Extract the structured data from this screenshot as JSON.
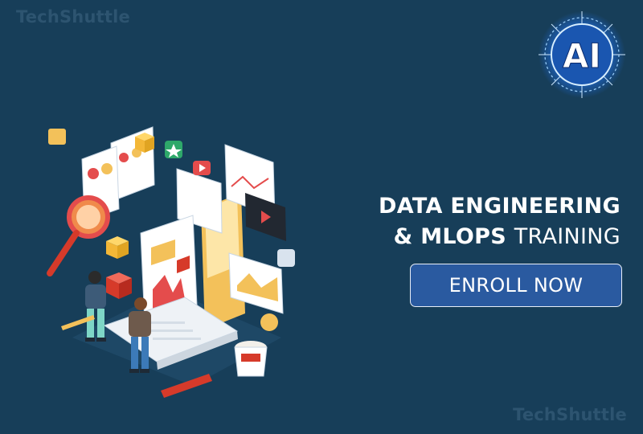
{
  "brand": {
    "name": "TechShuttle"
  },
  "badge": {
    "text": "AI"
  },
  "headline": {
    "line1": "DATA ENGINEERING",
    "line2_bold": "& MLOPS",
    "line2_light": "TRAINING"
  },
  "cta": {
    "label": "ENROLL NOW"
  },
  "colors": {
    "background": "#173e59",
    "button": "#2a5aa0",
    "watermark": "#2d5470",
    "accent_red": "#d63a2a",
    "accent_yellow": "#f3c15a"
  }
}
